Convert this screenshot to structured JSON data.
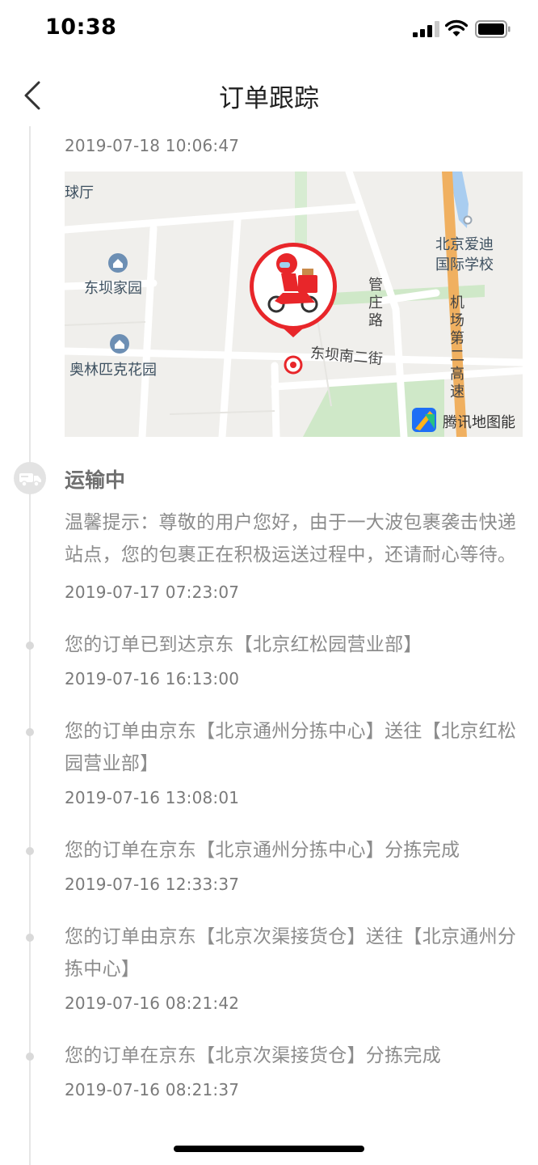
{
  "status_bar": {
    "time": "10:38"
  },
  "header": {
    "title": "订单跟踪"
  },
  "map": {
    "labels": {
      "ballroom": "球厅",
      "dongba_garden": "东坝家园",
      "olympic_garden": "奥林匹克花园",
      "school_line1": "北京爱迪",
      "school_line2": "国际学校",
      "guanzhuang_road": "管庄路",
      "dongba_south2": "东坝南二街",
      "airport_expressway": "机场第二高速",
      "provider": "腾讯地图能"
    },
    "colors": {
      "expressway": "#f0b060",
      "water": "#a9cdf0",
      "green": "#cfe8c8",
      "marker": "#e8262a"
    }
  },
  "timeline": [
    {
      "time": "2019-07-18 10:06:47"
    },
    {
      "status": "运输中",
      "text": "温馨提示：尊敬的用户您好，由于一大波包裹袭击快递站点，您的包裹正在积极运送过程中，还请耐心等待。",
      "time": "2019-07-17 07:23:07"
    },
    {
      "text": "您的订单已到达京东【北京红松园营业部】",
      "time": "2019-07-16 16:13:00"
    },
    {
      "text": "您的订单由京东【北京通州分拣中心】送往【北京红松园营业部】",
      "time": "2019-07-16 13:08:01"
    },
    {
      "text": "您的订单在京东【北京通州分拣中心】分拣完成",
      "time": "2019-07-16 12:33:37"
    },
    {
      "text": "您的订单由京东【北京次渠接货仓】送往【北京通州分拣中心】",
      "time": "2019-07-16 08:21:42"
    },
    {
      "text": "您的订单在京东【北京次渠接货仓】分拣完成",
      "time": "2019-07-16 08:21:37"
    }
  ]
}
